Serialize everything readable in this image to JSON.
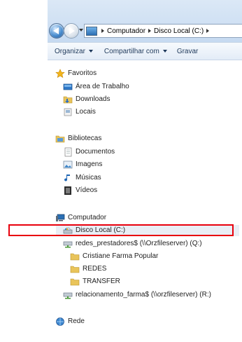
{
  "address_bar": {
    "segments": [
      "Computador",
      "Disco Local (C:)"
    ]
  },
  "toolbar": {
    "organize": "Organizar",
    "share": "Compartilhar com",
    "burn": "Gravar"
  },
  "favorites": {
    "header": "Favoritos",
    "items": [
      "Área de Trabalho",
      "Downloads",
      "Locais"
    ]
  },
  "libraries": {
    "header": "Bibliotecas",
    "items": [
      "Documentos",
      "Imagens",
      "Músicas",
      "Vídeos"
    ]
  },
  "computer": {
    "header": "Computador",
    "selected_item": "Disco Local (C:)",
    "drive_q": "redes_prestadores$ (\\\\Orzfileserver) (Q:)",
    "q_folders": [
      "Cristiane Farma Popular",
      "REDES",
      "TRANSFER"
    ],
    "drive_r": "relacionamento_farma$ (\\\\orzfileserver) (R:)"
  },
  "network": {
    "header": "Rede"
  },
  "colors": {
    "highlight": "#e8000d",
    "folder": "#e9c45a",
    "toolbar_text": "#1e395b"
  }
}
